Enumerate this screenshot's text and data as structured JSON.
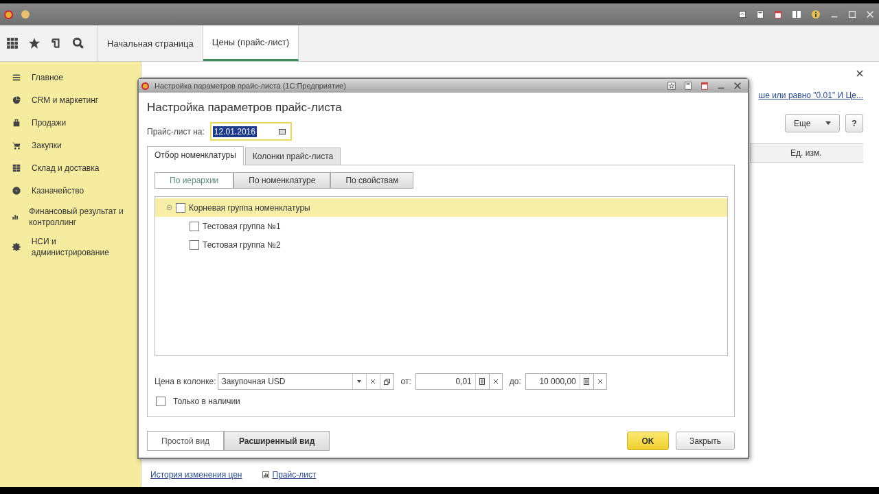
{
  "toolbar": {
    "tabs": [
      {
        "label": "Начальная страница",
        "selected": false
      },
      {
        "label": "Цены (прайс-лист)",
        "selected": true
      }
    ]
  },
  "sidebar": {
    "items": [
      {
        "label": "Главное"
      },
      {
        "label": "CRM и маркетинг"
      },
      {
        "label": "Продажи"
      },
      {
        "label": "Закупки"
      },
      {
        "label": "Склад и доставка"
      },
      {
        "label": "Казначейство"
      },
      {
        "label": "Финансовый результат и контроллинг"
      },
      {
        "label": "НСИ и администрирование"
      }
    ]
  },
  "background": {
    "filter_link": "ше или равно \"0.01\" И Це...",
    "more_button": "Еще",
    "help_button": "?",
    "column": "Ед. изм.",
    "links": [
      "История изменения цен",
      "Прайс-лист"
    ]
  },
  "dialog": {
    "title": "Настройка параметров прайс-листа (1С:Предприятие)",
    "heading": "Настройка параметров прайс-листа",
    "date_label": "Прайс-лист на:",
    "date_value": "12.01.2016",
    "tabs": [
      {
        "label": "Отбор номенклатуры",
        "selected": true
      },
      {
        "label": "Колонки прайс-листа",
        "selected": false
      }
    ],
    "subtabs": [
      {
        "label": "По иерархии",
        "selected": true
      },
      {
        "label": "По номенклатуре",
        "selected": false
      },
      {
        "label": "По свойствам",
        "selected": false
      }
    ],
    "tree": [
      {
        "label": "Корневая группа номенклатуры",
        "checked": false,
        "selected": true,
        "expanded": true,
        "children": [
          {
            "label": "Тестовая группа №1",
            "checked": false,
            "selected": false
          },
          {
            "label": "Тестовая группа №2",
            "checked": false,
            "selected": false
          }
        ]
      }
    ],
    "price_label": "Цена в колонке:",
    "price_column": "Закупочная USD",
    "from_label": "от:",
    "from_value": "0,01",
    "to_label": "до:",
    "to_value": "10 000,00",
    "in_stock": {
      "label": "Только в наличии",
      "checked": false
    },
    "views": [
      {
        "label": "Простой вид",
        "selected": true
      },
      {
        "label": "Расширенный вид",
        "selected": false
      }
    ],
    "ok_button": "OK",
    "close_button": "Закрыть"
  }
}
